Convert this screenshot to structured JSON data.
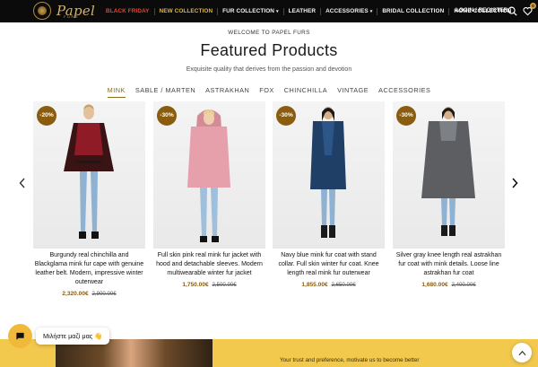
{
  "brand": {
    "logo_text": "Papel",
    "logo_subtext": "FURS"
  },
  "nav": {
    "items": [
      {
        "label": "BLACK FRIDAY",
        "color": "#e2462f",
        "caret": ""
      },
      {
        "label": "NEW COLLECTION",
        "color": "#e5b53d",
        "caret": ""
      },
      {
        "label": "FUR COLLECTION",
        "color": "#f3f3f3",
        "caret": "▾"
      },
      {
        "label": "LEATHER",
        "color": "#f3f3f3",
        "caret": ""
      },
      {
        "label": "ACCESSORIES",
        "color": "#f3f3f3",
        "caret": "▾"
      },
      {
        "label": "BRIDAL COLLECTION",
        "color": "#f3f3f3",
        "caret": ""
      },
      {
        "label": "HOME COLLECTION",
        "color": "#f3f3f3",
        "caret": ""
      }
    ],
    "login_label": "LOGIN / REGISTER",
    "search_icon": "search-icon",
    "wishlist_icon": "heart-icon",
    "wishlist_count": "0"
  },
  "welcome": "WELCOME TO PAPEL FURS",
  "heading": "Featured Products",
  "subheading": "Exquisite quality that derives from the passion and devotion",
  "categories": [
    {
      "label": "MINK",
      "active": true
    },
    {
      "label": "SABLE / MARTEN",
      "active": false
    },
    {
      "label": "ASTRAKHAN",
      "active": false
    },
    {
      "label": "FOX",
      "active": false
    },
    {
      "label": "CHINCHILLA",
      "active": false
    },
    {
      "label": "VINTAGE",
      "active": false
    },
    {
      "label": "ACCESSORIES",
      "active": false
    }
  ],
  "carousel": {
    "prev_icon": "chevron-left-icon",
    "next_icon": "chevron-right-icon"
  },
  "products": [
    {
      "discount": "-20%",
      "name": "Burgundy real chinchilla and Blackglama mink fur cape with genuine leather belt. Modern, impressive winter outerwear",
      "price_new": "2,320.00€",
      "price_old": "2,900.00€",
      "coat_color": "#3a1414",
      "coat_accent": "#8e1b25"
    },
    {
      "discount": "-30%",
      "name": "Full skin pink real mink fur jacket with hood and detachable sleeves. Modern multiwearable winter fur jacket",
      "price_new": "1,750.00€",
      "price_old": "2,500.00€",
      "coat_color": "#e6a0ac",
      "coat_accent": "#d48b98"
    },
    {
      "discount": "-30%",
      "name": "Navy blue mink fur coat with stand collar. Full skin winter fur coat. Knee length real mink fur outerwear",
      "price_new": "1,855.00€",
      "price_old": "2,650.00€",
      "coat_color": "#1f3f66",
      "coat_accent": "#2c5688"
    },
    {
      "discount": "-30%",
      "name": "Silver gray knee length real astrakhan fur coat with mink details. Loose line astrakhan fur coat",
      "price_new": "1,680.00€",
      "price_old": "2,400.00€",
      "coat_color": "#5c5e62",
      "coat_accent": "#7d8085"
    }
  ],
  "banner": {
    "text": "Your trust and preference, motivate us to become better"
  },
  "chat": {
    "icon": "chat-icon",
    "label": "Μιλήστε μαζί μας 👋"
  },
  "scroll_top_icon": "chevron-up-icon"
}
